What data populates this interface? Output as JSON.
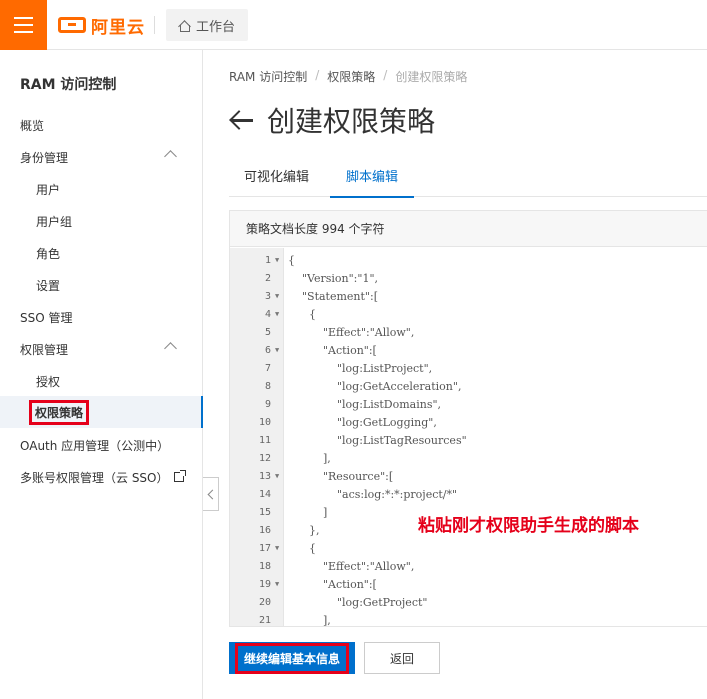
{
  "header": {
    "brand": "阿里云",
    "workbench": "工作台"
  },
  "sidebar": {
    "title": "RAM 访问控制",
    "items": [
      {
        "label": "概览"
      },
      {
        "label": "身份管理"
      },
      {
        "label": "用户"
      },
      {
        "label": "用户组"
      },
      {
        "label": "角色"
      },
      {
        "label": "设置"
      },
      {
        "label": "SSO 管理"
      },
      {
        "label": "权限管理"
      },
      {
        "label": "授权"
      },
      {
        "label": "权限策略"
      },
      {
        "label": "OAuth 应用管理（公测中）"
      },
      {
        "label": "多账号权限管理（云 SSO）"
      }
    ]
  },
  "breadcrumb": [
    "RAM 访问控制",
    "/",
    "权限策略",
    "/",
    "创建权限策略"
  ],
  "page_title": "创建权限策略",
  "tabs": [
    {
      "label": "可视化编辑"
    },
    {
      "label": "脚本编辑"
    }
  ],
  "editor": {
    "doc_length": "策略文档长度 994 个字符",
    "lines": [
      {
        "n": "1",
        "fold": "▼",
        "text": "{"
      },
      {
        "n": "2",
        "fold": "",
        "text": "    \"Version\":\"1\","
      },
      {
        "n": "3",
        "fold": "▼",
        "text": "    \"Statement\":["
      },
      {
        "n": "4",
        "fold": "▼",
        "text": "      {"
      },
      {
        "n": "5",
        "fold": "",
        "text": "          \"Effect\":\"Allow\","
      },
      {
        "n": "6",
        "fold": "▼",
        "text": "          \"Action\":["
      },
      {
        "n": "7",
        "fold": "",
        "text": "              \"log:ListProject\","
      },
      {
        "n": "8",
        "fold": "",
        "text": "              \"log:GetAcceleration\","
      },
      {
        "n": "9",
        "fold": "",
        "text": "              \"log:ListDomains\","
      },
      {
        "n": "10",
        "fold": "",
        "text": "              \"log:GetLogging\","
      },
      {
        "n": "11",
        "fold": "",
        "text": "              \"log:ListTagResources\""
      },
      {
        "n": "12",
        "fold": "",
        "text": "          ],"
      },
      {
        "n": "13",
        "fold": "▼",
        "text": "          \"Resource\":["
      },
      {
        "n": "14",
        "fold": "",
        "text": "              \"acs:log:*:*:project/*\""
      },
      {
        "n": "15",
        "fold": "",
        "text": "          ]"
      },
      {
        "n": "16",
        "fold": "",
        "text": "      },"
      },
      {
        "n": "17",
        "fold": "▼",
        "text": "      {"
      },
      {
        "n": "18",
        "fold": "",
        "text": "          \"Effect\":\"Allow\","
      },
      {
        "n": "19",
        "fold": "▼",
        "text": "          \"Action\":["
      },
      {
        "n": "20",
        "fold": "",
        "text": "              \"log:GetProject\""
      },
      {
        "n": "21",
        "fold": "",
        "text": "          ],"
      }
    ]
  },
  "annotation": "粘贴刚才权限助手生成的脚本",
  "buttons": {
    "continue": "继续编辑基本信息",
    "back": "返回"
  },
  "colors": {
    "brand": "#ff6a00",
    "primary": "#0070cc",
    "highlight": "#e5001a"
  }
}
